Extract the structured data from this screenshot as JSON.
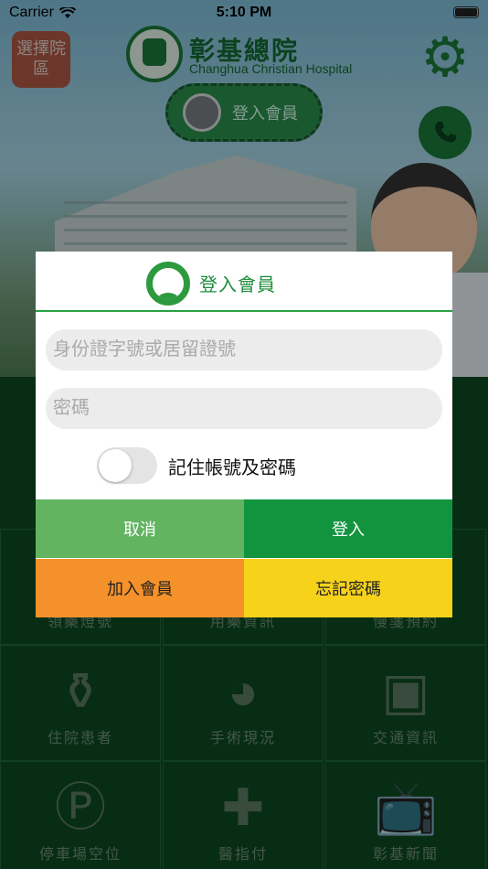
{
  "status_bar": {
    "carrier": "Carrier",
    "time": "5:10 PM"
  },
  "header": {
    "region_button": "選擇院區",
    "hospital_name": "彰基總院",
    "hospital_name_en": "Changhua Christian Hospital",
    "member_button": "登入會員"
  },
  "grid": {
    "items": [
      {
        "label": "領藥燈號",
        "icon": "medicine-icon"
      },
      {
        "label": "用藥資訊",
        "icon": "pill-icon"
      },
      {
        "label": "慢箋預約",
        "icon": "calendar-icon"
      },
      {
        "label": "住院患者",
        "icon": "iv-drip-icon"
      },
      {
        "label": "手術現況",
        "icon": "surgery-icon"
      },
      {
        "label": "交通資訊",
        "icon": "bus-icon"
      },
      {
        "label": "停車場空位",
        "icon": "parking-icon"
      },
      {
        "label": "醫指付",
        "icon": "payment-icon"
      },
      {
        "label": "彰基新聞",
        "icon": "tv-icon"
      }
    ]
  },
  "login_dialog": {
    "title": "登入會員",
    "id_placeholder": "身份證字號或居留證號",
    "password_placeholder": "密碼",
    "remember_label": "記住帳號及密碼",
    "remember_on": false,
    "cancel_label": "取消",
    "login_label": "登入",
    "join_label": "加入會員",
    "forgot_label": "忘記密碼"
  },
  "colors": {
    "brand_green": "#12943f",
    "cancel_green": "#62b461",
    "join_orange": "#f5912a",
    "forgot_yellow": "#f6d21a"
  }
}
